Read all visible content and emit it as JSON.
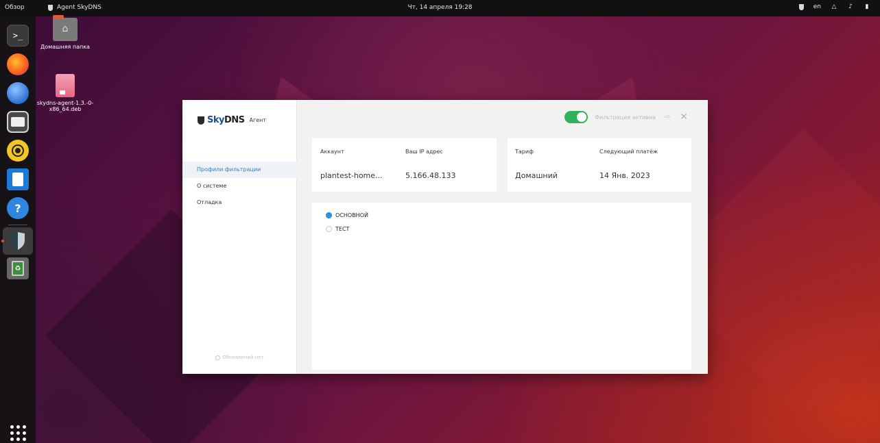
{
  "topbar": {
    "overview": "Обзор",
    "app_name": "Agent SkyDNS",
    "clock": "Чт, 14 апреля 19:28",
    "lang": "en"
  },
  "dock": {
    "items": [
      "terminal",
      "firefox",
      "thunderbird",
      "files",
      "rhythmbox",
      "libreoffice-writer",
      "help",
      "skydns-agent",
      "trash",
      "show-apps"
    ]
  },
  "desktop": {
    "home_folder_label": "Домашняя папка",
    "deb_file_label": "skydns-agent-1.3.-0-x86_64.deb"
  },
  "app": {
    "logo": {
      "brand_sky": "Sky",
      "brand_dns": "DNS",
      "suffix": "Агент"
    },
    "nav": [
      {
        "label": "Профили фильтрации",
        "active": true
      },
      {
        "label": "О системе",
        "active": false
      },
      {
        "label": "Отладка",
        "active": false
      }
    ],
    "update_status": "Обновлений нет",
    "filter": {
      "enabled": true,
      "status_label": "Фильтрация активна"
    },
    "account_card": {
      "account_label": "Аккаунт",
      "account_value": "plantest-home...",
      "ip_label": "Ваш IP адрес",
      "ip_value": "5.166.48.133"
    },
    "tariff_card": {
      "tariff_label": "Тариф",
      "tariff_value": "Домашний",
      "next_payment_label": "Следующий платёж",
      "next_payment_value": "14 Янв. 2023"
    },
    "profiles": [
      {
        "label": "ОСНОВНОЙ",
        "selected": true
      },
      {
        "label": "ТЕСТ",
        "selected": false
      }
    ]
  },
  "colors": {
    "accent": "#2f8fe0",
    "toggle_on": "#2fb25a",
    "ubuntu_orange": "#e95420"
  }
}
